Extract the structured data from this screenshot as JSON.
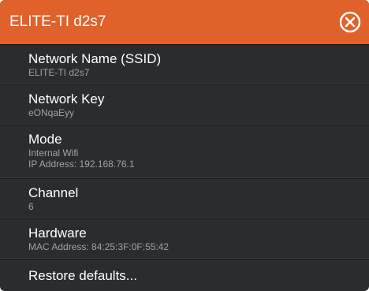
{
  "dialog": {
    "title": "ELITE-TI d2s7",
    "close_icon": "circle-x-icon",
    "accent_color": "#e0622a",
    "background_color": "#2a2d30"
  },
  "items": [
    {
      "label": "Network Name (SSID)",
      "sub": [
        "ELITE-TI d2s7"
      ]
    },
    {
      "label": "Network Key",
      "sub": [
        "eONqaEyy"
      ]
    },
    {
      "label": "Mode",
      "sub": [
        "Internal Wifi",
        "IP Address: 192.168.76.1"
      ]
    },
    {
      "label": "Channel",
      "sub": [
        "6"
      ]
    },
    {
      "label": "Hardware",
      "sub": [
        "MAC Address: 84:25:3F:0F:55:42"
      ]
    },
    {
      "label": "Restore defaults..."
    }
  ]
}
